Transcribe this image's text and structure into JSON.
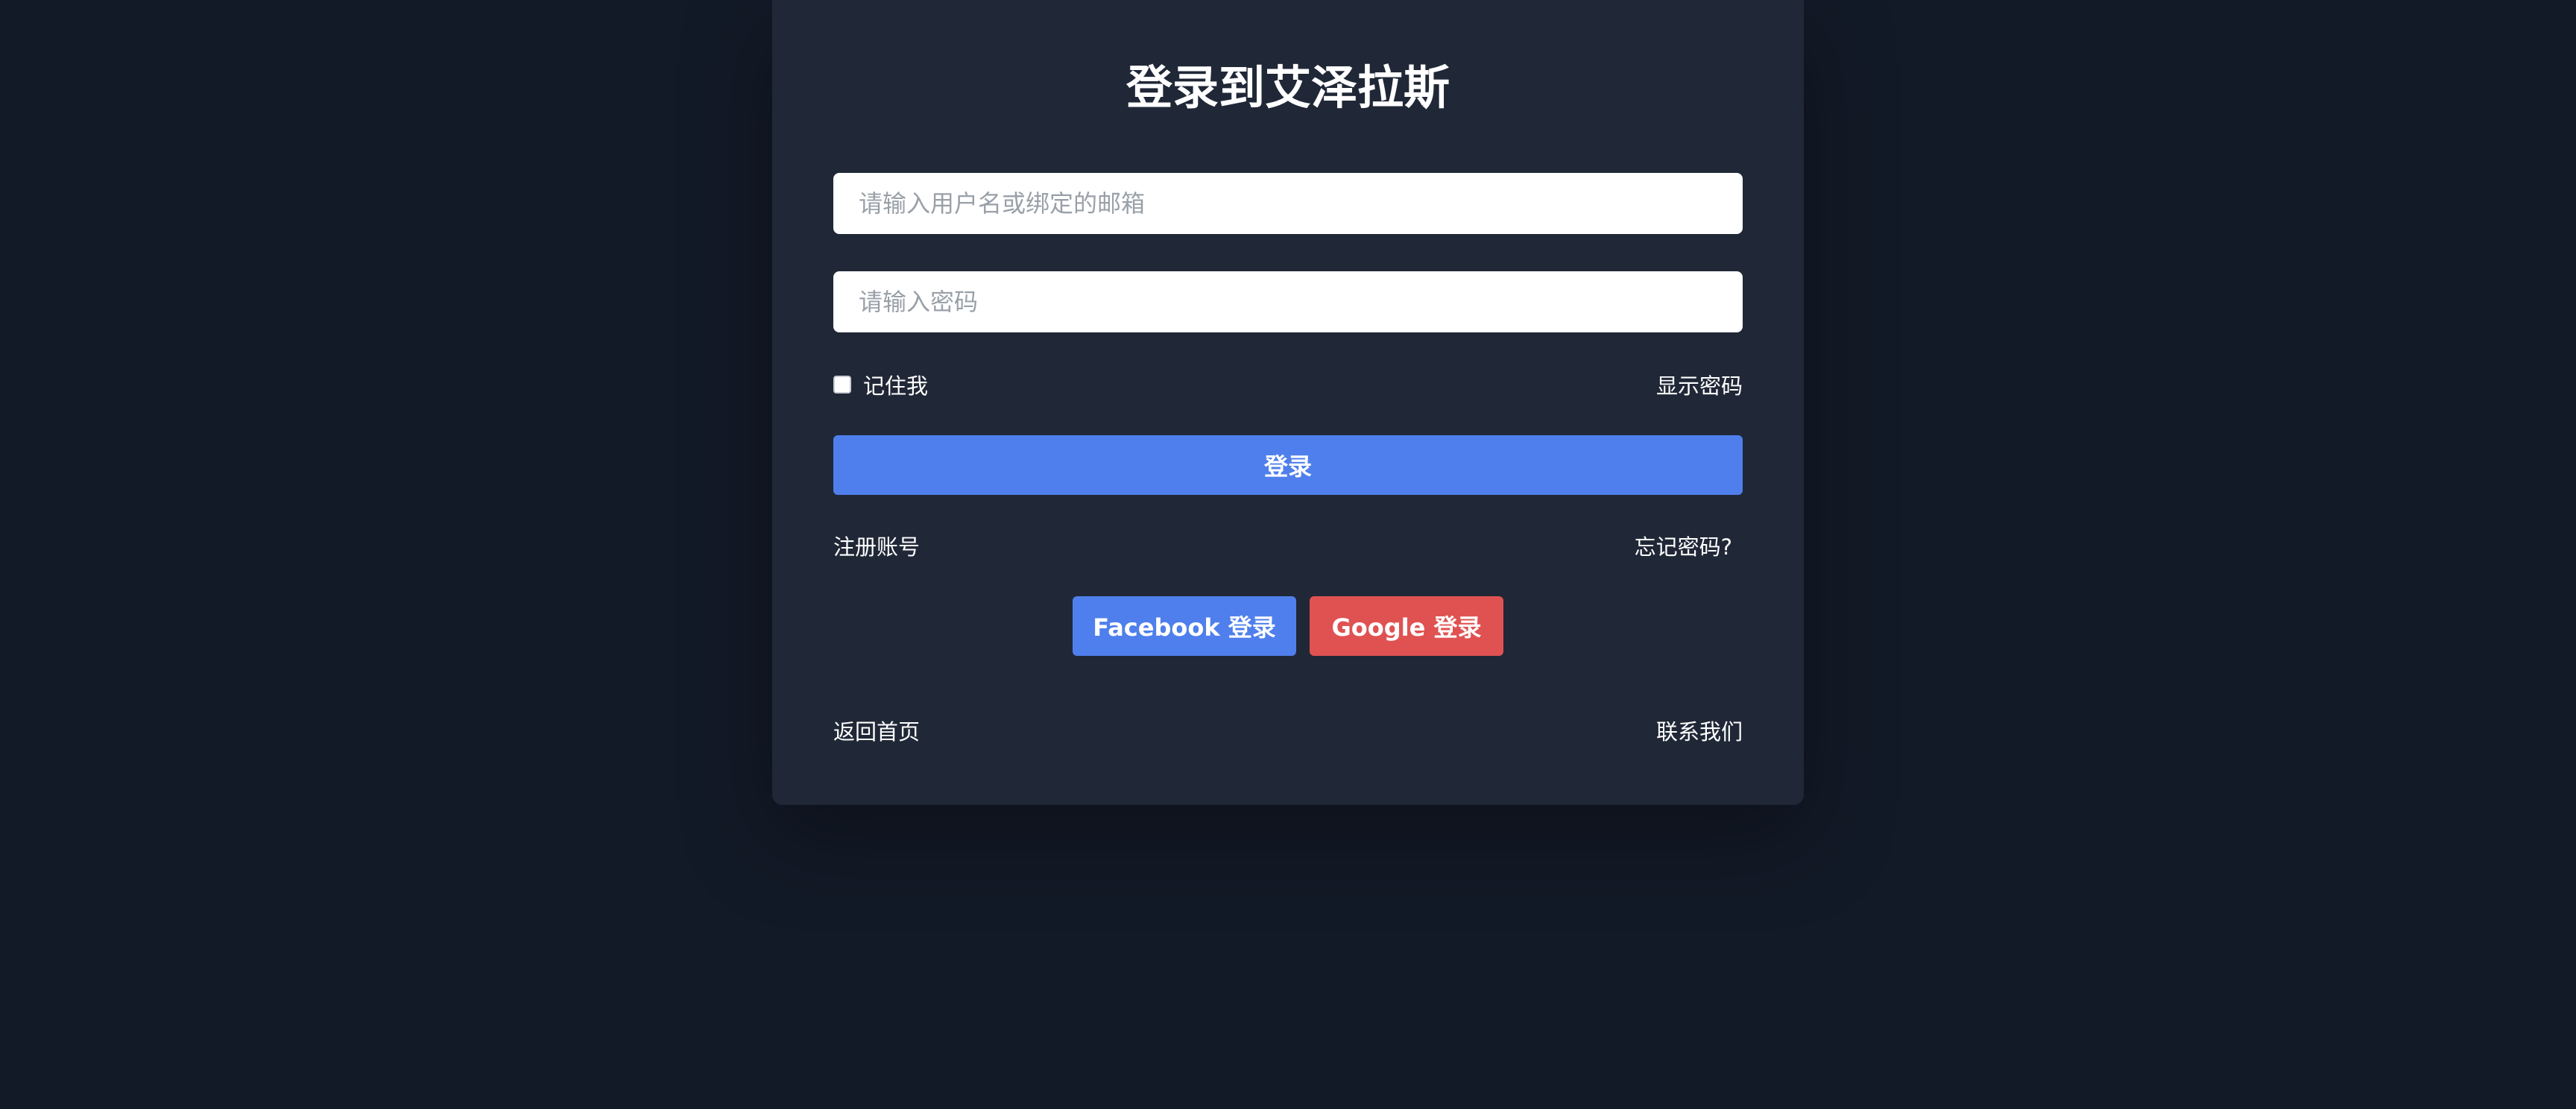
{
  "login": {
    "title": "登录到艾泽拉斯",
    "username_placeholder": "请输入用户名或绑定的邮箱",
    "username_value": "",
    "password_placeholder": "请输入密码",
    "password_value": "",
    "remember_label": "记住我",
    "remember_checked": false,
    "show_password_label": "显示密码",
    "submit_label": "登录",
    "register_label": "注册账号",
    "forgot_label": "忘记密码?",
    "facebook_label": "Facebook 登录",
    "google_label": "Google 登录",
    "home_label": "返回首页",
    "contact_label": "联系我们"
  },
  "colors": {
    "page_bg": "#131a27",
    "card_bg": "#202837",
    "primary": "#4f7fec",
    "google": "#e05252",
    "text": "#ffffff"
  }
}
